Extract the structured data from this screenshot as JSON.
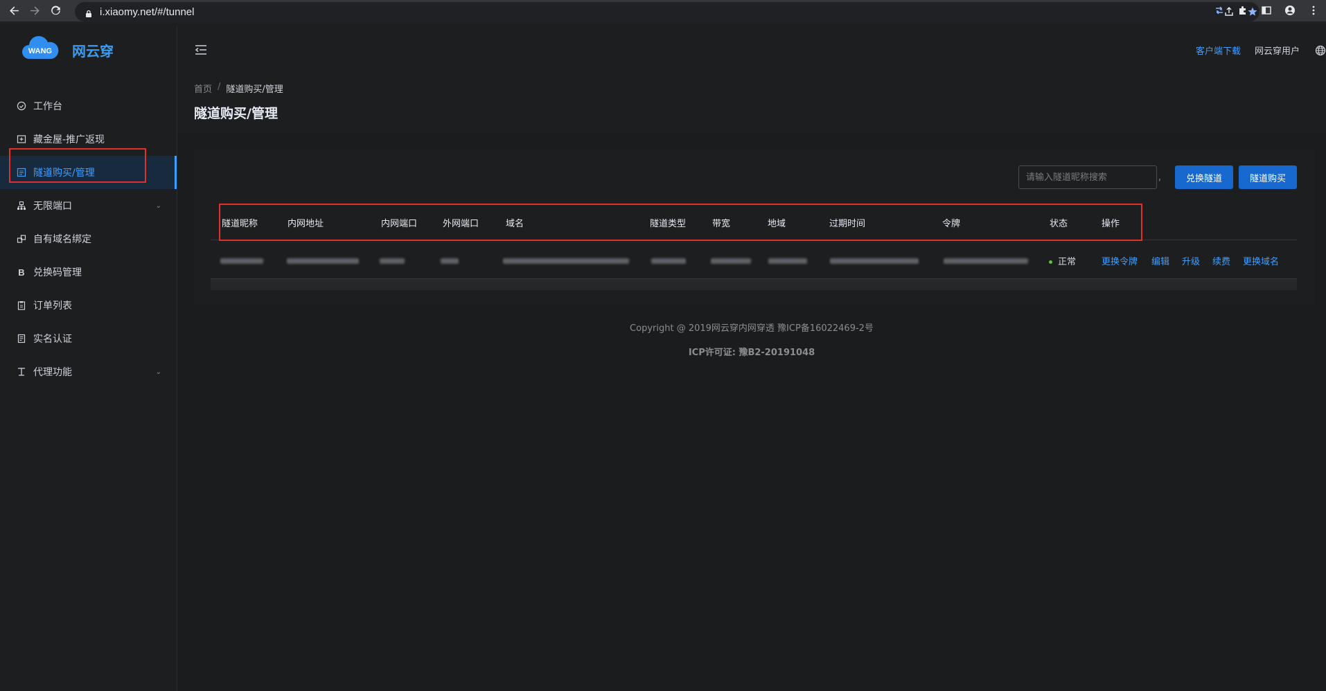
{
  "browser": {
    "url": "i.xiaomy.net/#/tunnel"
  },
  "sidebar": {
    "logo_badge": "WANG",
    "logo_text": "网云穿",
    "items": [
      {
        "label": "工作台",
        "icon": "dashboard-icon"
      },
      {
        "label": "藏金屋-推广返现",
        "icon": "gift-icon"
      },
      {
        "label": "隧道购买/管理",
        "icon": "tunnel-icon",
        "active": true
      },
      {
        "label": "无限端口",
        "icon": "network-icon",
        "expandable": true
      },
      {
        "label": "自有域名绑定",
        "icon": "link-icon"
      },
      {
        "label": "兑换码管理",
        "icon": "b-icon"
      },
      {
        "label": "订单列表",
        "icon": "order-icon"
      },
      {
        "label": "实名认证",
        "icon": "id-icon"
      },
      {
        "label": "代理功能",
        "icon": "proxy-icon",
        "expandable": true
      }
    ]
  },
  "header": {
    "download": "客户端下载",
    "user": "网云穿用户"
  },
  "breadcrumb": {
    "home": "首页",
    "separator": "/",
    "current": "隧道购买/管理"
  },
  "page_title": "隧道购买/管理",
  "toolbar": {
    "search_placeholder": "请输入隧道昵称搜索",
    "comma": ",",
    "exchange_button": "兑换隧道",
    "buy_button": "隧道购买"
  },
  "table": {
    "headers": [
      "隧道昵称",
      "内网地址",
      "内网端口",
      "外网端口",
      "域名",
      "隧道类型",
      "带宽",
      "地域",
      "过期时间",
      "令牌",
      "状态",
      "操作"
    ],
    "rows": [
      {
        "status": "正常",
        "actions": [
          "更换令牌",
          "编辑",
          "升级",
          "续费",
          "更换域名"
        ]
      }
    ]
  },
  "footer": {
    "copyright": "Copyright @ 2019网云穿内网穿透 豫ICP备16022469-2号",
    "icp": "ICP许可证: 豫B2-20191048"
  },
  "colors": {
    "accent": "#409eff",
    "primary_button": "#1769cf",
    "highlight_box": "#e0312c",
    "status_ok": "#67c23a"
  }
}
